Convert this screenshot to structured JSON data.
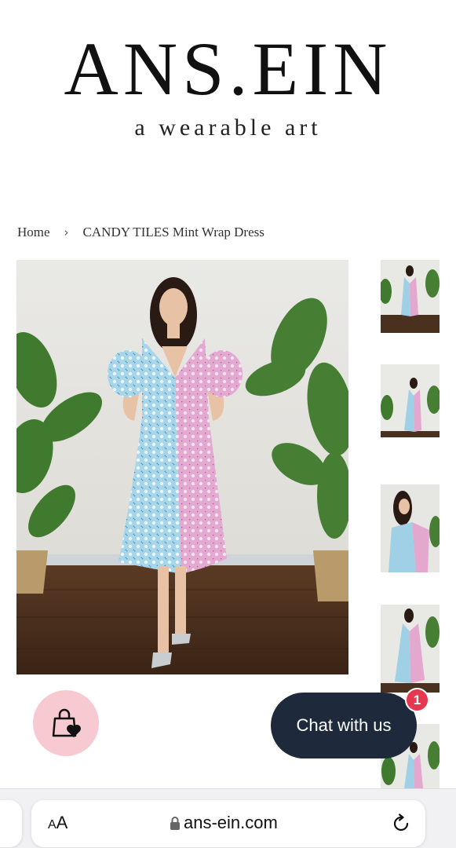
{
  "brand": {
    "logo_text": "ANS.EIN",
    "tagline": "a wearable art"
  },
  "breadcrumb": {
    "home": "Home",
    "separator": "›",
    "current": "CANDY TILES Mint Wrap Dress"
  },
  "gallery": {
    "main_image_icon": "product-photo-woman-wrap-dress",
    "thumbnail_count": 5
  },
  "chat": {
    "label": "Chat with us",
    "badge_count": "1"
  },
  "browser": {
    "text_size_label_small": "A",
    "text_size_label_big": "A",
    "url": "ans-ein.com"
  },
  "colors": {
    "bag_button_bg": "#f7c9d0",
    "chat_button_bg": "#1e2a3b",
    "badge_red": "#e53950",
    "dress_blue": "#9fd0e6",
    "dress_pink": "#e4a8cf"
  }
}
